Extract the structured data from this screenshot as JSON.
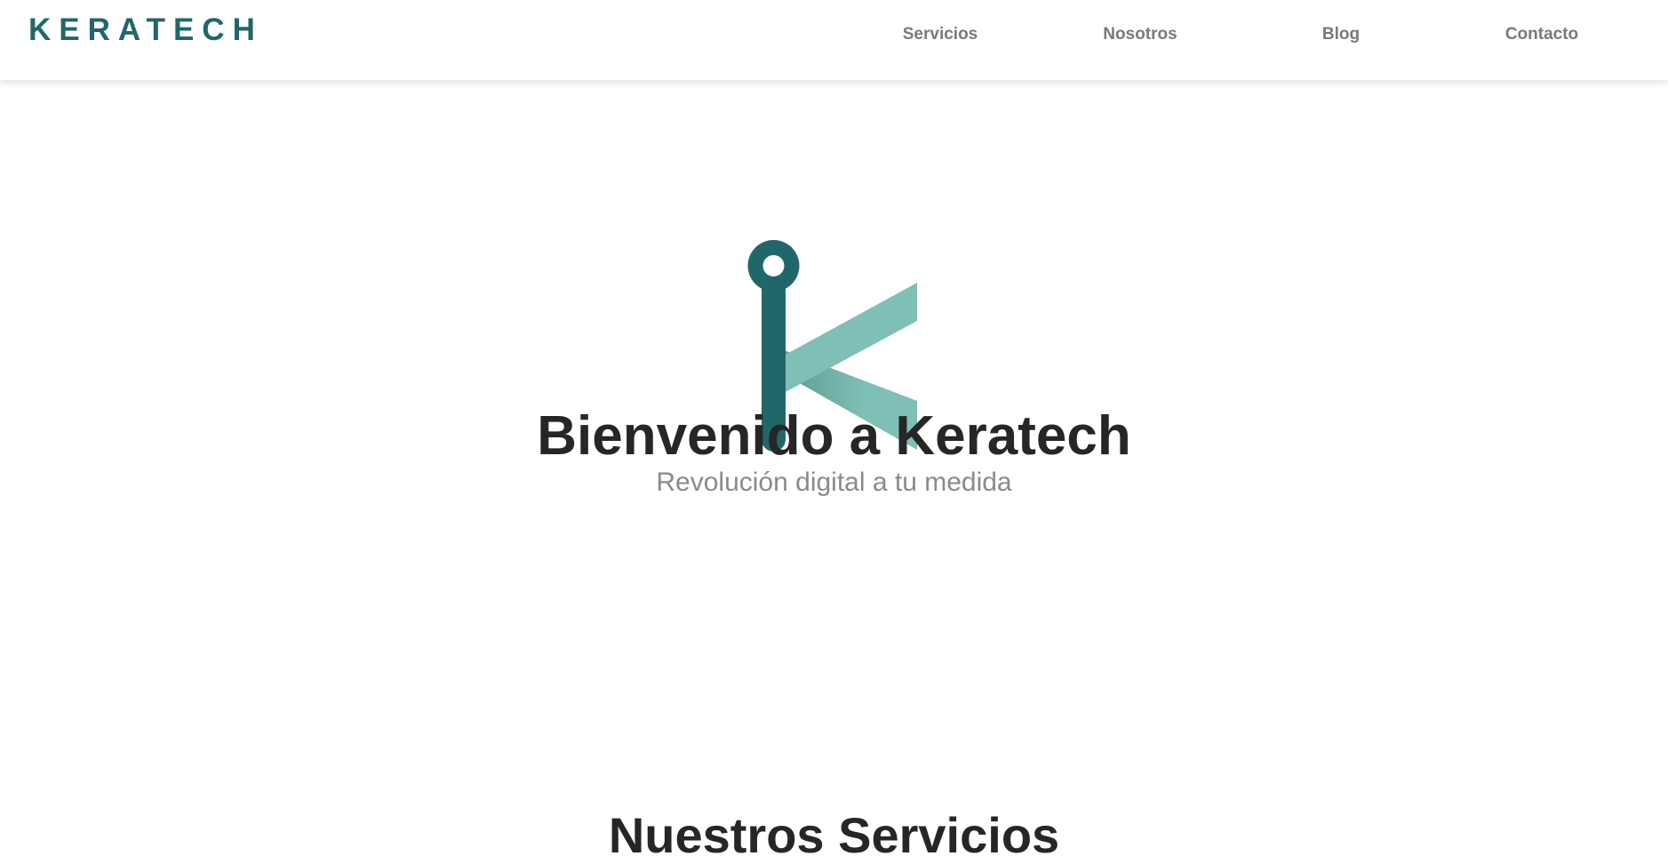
{
  "header": {
    "brand": "KERATECH",
    "nav": [
      {
        "label": "Servicios"
      },
      {
        "label": "Nosotros"
      },
      {
        "label": "Blog"
      },
      {
        "label": "Contacto"
      }
    ]
  },
  "hero": {
    "logo_icon": "keratech-k-logo-icon",
    "title": "Bienvenido a Keratech",
    "subtitle": "Revolución digital a tu medida"
  },
  "services": {
    "title": "Nuestros Servicios"
  },
  "colors": {
    "brand_dark": "#21676a",
    "brand_light": "#7ebfb6",
    "text_dark": "#262626",
    "text_muted": "#8a8a8a",
    "nav_text": "#7a7a7a"
  }
}
